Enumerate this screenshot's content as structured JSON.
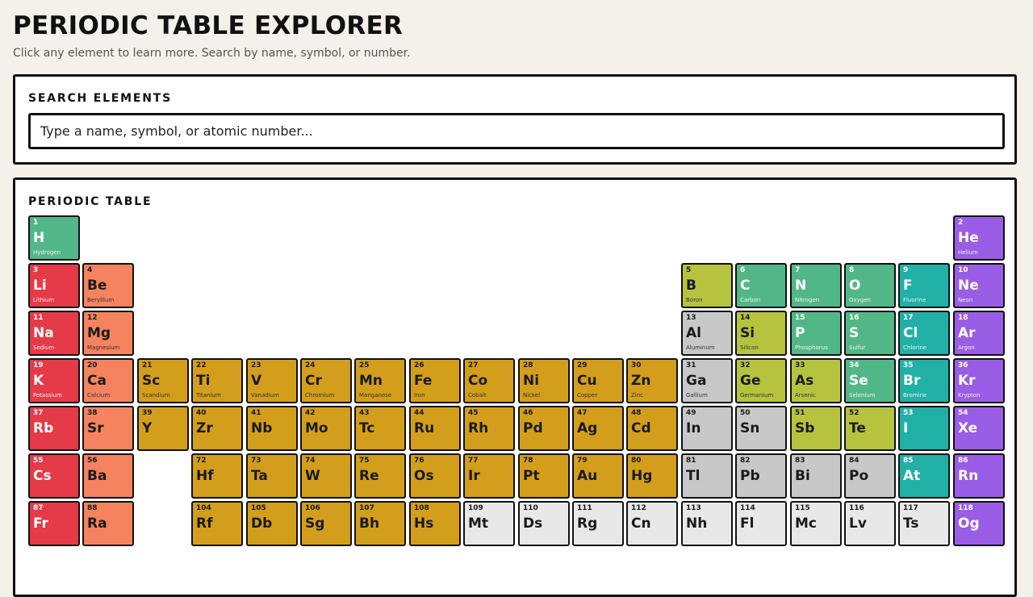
{
  "header": {
    "title": "PERIODIC TABLE EXPLORER",
    "subtitle": "Click any element to learn more. Search by name, symbol, or number."
  },
  "search": {
    "heading": "SEARCH ELEMENTS",
    "placeholder": "Type a name, symbol, or atomic number..."
  },
  "table": {
    "heading": "PERIODIC TABLE"
  },
  "colors": {
    "alkali": "#e53a48",
    "alkaline": "#f5835f",
    "transition": "#d39e1b",
    "post": "#c8c8c8",
    "metalloid": "#b6c33f",
    "nonmetal": "#52b788",
    "halogen": "#21b0a6",
    "noble": "#9a5de5",
    "unknown": "#e8e8e8"
  },
  "elements": [
    {
      "n": 1,
      "s": "H",
      "name": "Hydrogen",
      "row": 1,
      "col": 1,
      "cat": "nonmetal"
    },
    {
      "n": 2,
      "s": "He",
      "name": "Helium",
      "row": 1,
      "col": 18,
      "cat": "noble"
    },
    {
      "n": 3,
      "s": "Li",
      "name": "Lithium",
      "row": 2,
      "col": 1,
      "cat": "alkali"
    },
    {
      "n": 4,
      "s": "Be",
      "name": "Beryllium",
      "row": 2,
      "col": 2,
      "cat": "alkaline"
    },
    {
      "n": 5,
      "s": "B",
      "name": "Boron",
      "row": 2,
      "col": 13,
      "cat": "metalloid"
    },
    {
      "n": 6,
      "s": "C",
      "name": "Carbon",
      "row": 2,
      "col": 14,
      "cat": "nonmetal"
    },
    {
      "n": 7,
      "s": "N",
      "name": "Nitrogen",
      "row": 2,
      "col": 15,
      "cat": "nonmetal"
    },
    {
      "n": 8,
      "s": "O",
      "name": "Oxygen",
      "row": 2,
      "col": 16,
      "cat": "nonmetal"
    },
    {
      "n": 9,
      "s": "F",
      "name": "Fluorine",
      "row": 2,
      "col": 17,
      "cat": "halogen"
    },
    {
      "n": 10,
      "s": "Ne",
      "name": "Neon",
      "row": 2,
      "col": 18,
      "cat": "noble"
    },
    {
      "n": 11,
      "s": "Na",
      "name": "Sodium",
      "row": 3,
      "col": 1,
      "cat": "alkali"
    },
    {
      "n": 12,
      "s": "Mg",
      "name": "Magnesium",
      "row": 3,
      "col": 2,
      "cat": "alkaline"
    },
    {
      "n": 13,
      "s": "Al",
      "name": "Aluminum",
      "row": 3,
      "col": 13,
      "cat": "post"
    },
    {
      "n": 14,
      "s": "Si",
      "name": "Silicon",
      "row": 3,
      "col": 14,
      "cat": "metalloid"
    },
    {
      "n": 15,
      "s": "P",
      "name": "Phosphorus",
      "row": 3,
      "col": 15,
      "cat": "nonmetal"
    },
    {
      "n": 16,
      "s": "S",
      "name": "Sulfur",
      "row": 3,
      "col": 16,
      "cat": "nonmetal"
    },
    {
      "n": 17,
      "s": "Cl",
      "name": "Chlorine",
      "row": 3,
      "col": 17,
      "cat": "halogen"
    },
    {
      "n": 18,
      "s": "Ar",
      "name": "Argon",
      "row": 3,
      "col": 18,
      "cat": "noble"
    },
    {
      "n": 19,
      "s": "K",
      "name": "Potassium",
      "row": 4,
      "col": 1,
      "cat": "alkali"
    },
    {
      "n": 20,
      "s": "Ca",
      "name": "Calcium",
      "row": 4,
      "col": 2,
      "cat": "alkaline"
    },
    {
      "n": 21,
      "s": "Sc",
      "name": "Scandium",
      "row": 4,
      "col": 3,
      "cat": "transition"
    },
    {
      "n": 22,
      "s": "Ti",
      "name": "Titanium",
      "row": 4,
      "col": 4,
      "cat": "transition"
    },
    {
      "n": 23,
      "s": "V",
      "name": "Vanadium",
      "row": 4,
      "col": 5,
      "cat": "transition"
    },
    {
      "n": 24,
      "s": "Cr",
      "name": "Chromium",
      "row": 4,
      "col": 6,
      "cat": "transition"
    },
    {
      "n": 25,
      "s": "Mn",
      "name": "Manganese",
      "row": 4,
      "col": 7,
      "cat": "transition"
    },
    {
      "n": 26,
      "s": "Fe",
      "name": "Iron",
      "row": 4,
      "col": 8,
      "cat": "transition"
    },
    {
      "n": 27,
      "s": "Co",
      "name": "Cobalt",
      "row": 4,
      "col": 9,
      "cat": "transition"
    },
    {
      "n": 28,
      "s": "Ni",
      "name": "Nickel",
      "row": 4,
      "col": 10,
      "cat": "transition"
    },
    {
      "n": 29,
      "s": "Cu",
      "name": "Copper",
      "row": 4,
      "col": 11,
      "cat": "transition"
    },
    {
      "n": 30,
      "s": "Zn",
      "name": "Zinc",
      "row": 4,
      "col": 12,
      "cat": "transition"
    },
    {
      "n": 31,
      "s": "Ga",
      "name": "Gallium",
      "row": 4,
      "col": 13,
      "cat": "post"
    },
    {
      "n": 32,
      "s": "Ge",
      "name": "Germanium",
      "row": 4,
      "col": 14,
      "cat": "metalloid"
    },
    {
      "n": 33,
      "s": "As",
      "name": "Arsenic",
      "row": 4,
      "col": 15,
      "cat": "metalloid"
    },
    {
      "n": 34,
      "s": "Se",
      "name": "Selenium",
      "row": 4,
      "col": 16,
      "cat": "nonmetal"
    },
    {
      "n": 35,
      "s": "Br",
      "name": "Bromine",
      "row": 4,
      "col": 17,
      "cat": "halogen"
    },
    {
      "n": 36,
      "s": "Kr",
      "name": "Krypton",
      "row": 4,
      "col": 18,
      "cat": "noble"
    },
    {
      "n": 37,
      "s": "Rb",
      "name": "",
      "row": 5,
      "col": 1,
      "cat": "alkali"
    },
    {
      "n": 38,
      "s": "Sr",
      "name": "",
      "row": 5,
      "col": 2,
      "cat": "alkaline"
    },
    {
      "n": 39,
      "s": "Y",
      "name": "",
      "row": 5,
      "col": 3,
      "cat": "transition"
    },
    {
      "n": 40,
      "s": "Zr",
      "name": "",
      "row": 5,
      "col": 4,
      "cat": "transition"
    },
    {
      "n": 41,
      "s": "Nb",
      "name": "",
      "row": 5,
      "col": 5,
      "cat": "transition"
    },
    {
      "n": 42,
      "s": "Mo",
      "name": "",
      "row": 5,
      "col": 6,
      "cat": "transition"
    },
    {
      "n": 43,
      "s": "Tc",
      "name": "",
      "row": 5,
      "col": 7,
      "cat": "transition"
    },
    {
      "n": 44,
      "s": "Ru",
      "name": "",
      "row": 5,
      "col": 8,
      "cat": "transition"
    },
    {
      "n": 45,
      "s": "Rh",
      "name": "",
      "row": 5,
      "col": 9,
      "cat": "transition"
    },
    {
      "n": 46,
      "s": "Pd",
      "name": "",
      "row": 5,
      "col": 10,
      "cat": "transition"
    },
    {
      "n": 47,
      "s": "Ag",
      "name": "",
      "row": 5,
      "col": 11,
      "cat": "transition"
    },
    {
      "n": 48,
      "s": "Cd",
      "name": "",
      "row": 5,
      "col": 12,
      "cat": "transition"
    },
    {
      "n": 49,
      "s": "In",
      "name": "",
      "row": 5,
      "col": 13,
      "cat": "post"
    },
    {
      "n": 50,
      "s": "Sn",
      "name": "",
      "row": 5,
      "col": 14,
      "cat": "post"
    },
    {
      "n": 51,
      "s": "Sb",
      "name": "",
      "row": 5,
      "col": 15,
      "cat": "metalloid"
    },
    {
      "n": 52,
      "s": "Te",
      "name": "",
      "row": 5,
      "col": 16,
      "cat": "metalloid"
    },
    {
      "n": 53,
      "s": "I",
      "name": "",
      "row": 5,
      "col": 17,
      "cat": "halogen"
    },
    {
      "n": 54,
      "s": "Xe",
      "name": "",
      "row": 5,
      "col": 18,
      "cat": "noble"
    },
    {
      "n": 55,
      "s": "Cs",
      "name": "",
      "row": 6,
      "col": 1,
      "cat": "alkali"
    },
    {
      "n": 56,
      "s": "Ba",
      "name": "",
      "row": 6,
      "col": 2,
      "cat": "alkaline"
    },
    {
      "n": 72,
      "s": "Hf",
      "name": "",
      "row": 6,
      "col": 4,
      "cat": "transition"
    },
    {
      "n": 73,
      "s": "Ta",
      "name": "",
      "row": 6,
      "col": 5,
      "cat": "transition"
    },
    {
      "n": 74,
      "s": "W",
      "name": "",
      "row": 6,
      "col": 6,
      "cat": "transition"
    },
    {
      "n": 75,
      "s": "Re",
      "name": "",
      "row": 6,
      "col": 7,
      "cat": "transition"
    },
    {
      "n": 76,
      "s": "Os",
      "name": "",
      "row": 6,
      "col": 8,
      "cat": "transition"
    },
    {
      "n": 77,
      "s": "Ir",
      "name": "",
      "row": 6,
      "col": 9,
      "cat": "transition"
    },
    {
      "n": 78,
      "s": "Pt",
      "name": "",
      "row": 6,
      "col": 10,
      "cat": "transition"
    },
    {
      "n": 79,
      "s": "Au",
      "name": "",
      "row": 6,
      "col": 11,
      "cat": "transition"
    },
    {
      "n": 80,
      "s": "Hg",
      "name": "",
      "row": 6,
      "col": 12,
      "cat": "transition"
    },
    {
      "n": 81,
      "s": "Tl",
      "name": "",
      "row": 6,
      "col": 13,
      "cat": "post"
    },
    {
      "n": 82,
      "s": "Pb",
      "name": "",
      "row": 6,
      "col": 14,
      "cat": "post"
    },
    {
      "n": 83,
      "s": "Bi",
      "name": "",
      "row": 6,
      "col": 15,
      "cat": "post"
    },
    {
      "n": 84,
      "s": "Po",
      "name": "",
      "row": 6,
      "col": 16,
      "cat": "post"
    },
    {
      "n": 85,
      "s": "At",
      "name": "",
      "row": 6,
      "col": 17,
      "cat": "halogen"
    },
    {
      "n": 86,
      "s": "Rn",
      "name": "",
      "row": 6,
      "col": 18,
      "cat": "noble"
    },
    {
      "n": 87,
      "s": "Fr",
      "name": "",
      "row": 7,
      "col": 1,
      "cat": "alkali"
    },
    {
      "n": 88,
      "s": "Ra",
      "name": "",
      "row": 7,
      "col": 2,
      "cat": "alkaline"
    },
    {
      "n": 104,
      "s": "Rf",
      "name": "",
      "row": 7,
      "col": 4,
      "cat": "transition"
    },
    {
      "n": 105,
      "s": "Db",
      "name": "",
      "row": 7,
      "col": 5,
      "cat": "transition"
    },
    {
      "n": 106,
      "s": "Sg",
      "name": "",
      "row": 7,
      "col": 6,
      "cat": "transition"
    },
    {
      "n": 107,
      "s": "Bh",
      "name": "",
      "row": 7,
      "col": 7,
      "cat": "transition"
    },
    {
      "n": 108,
      "s": "Hs",
      "name": "",
      "row": 7,
      "col": 8,
      "cat": "transition"
    },
    {
      "n": 109,
      "s": "Mt",
      "name": "",
      "row": 7,
      "col": 9,
      "cat": "unknown"
    },
    {
      "n": 110,
      "s": "Ds",
      "name": "",
      "row": 7,
      "col": 10,
      "cat": "unknown"
    },
    {
      "n": 111,
      "s": "Rg",
      "name": "",
      "row": 7,
      "col": 11,
      "cat": "unknown"
    },
    {
      "n": 112,
      "s": "Cn",
      "name": "",
      "row": 7,
      "col": 12,
      "cat": "unknown"
    },
    {
      "n": 113,
      "s": "Nh",
      "name": "",
      "row": 7,
      "col": 13,
      "cat": "unknown"
    },
    {
      "n": 114,
      "s": "Fl",
      "name": "",
      "row": 7,
      "col": 14,
      "cat": "unknown"
    },
    {
      "n": 115,
      "s": "Mc",
      "name": "",
      "row": 7,
      "col": 15,
      "cat": "unknown"
    },
    {
      "n": 116,
      "s": "Lv",
      "name": "",
      "row": 7,
      "col": 16,
      "cat": "unknown"
    },
    {
      "n": 117,
      "s": "Ts",
      "name": "",
      "row": 7,
      "col": 17,
      "cat": "unknown"
    },
    {
      "n": 118,
      "s": "Og",
      "name": "",
      "row": 7,
      "col": 18,
      "cat": "noble"
    }
  ]
}
